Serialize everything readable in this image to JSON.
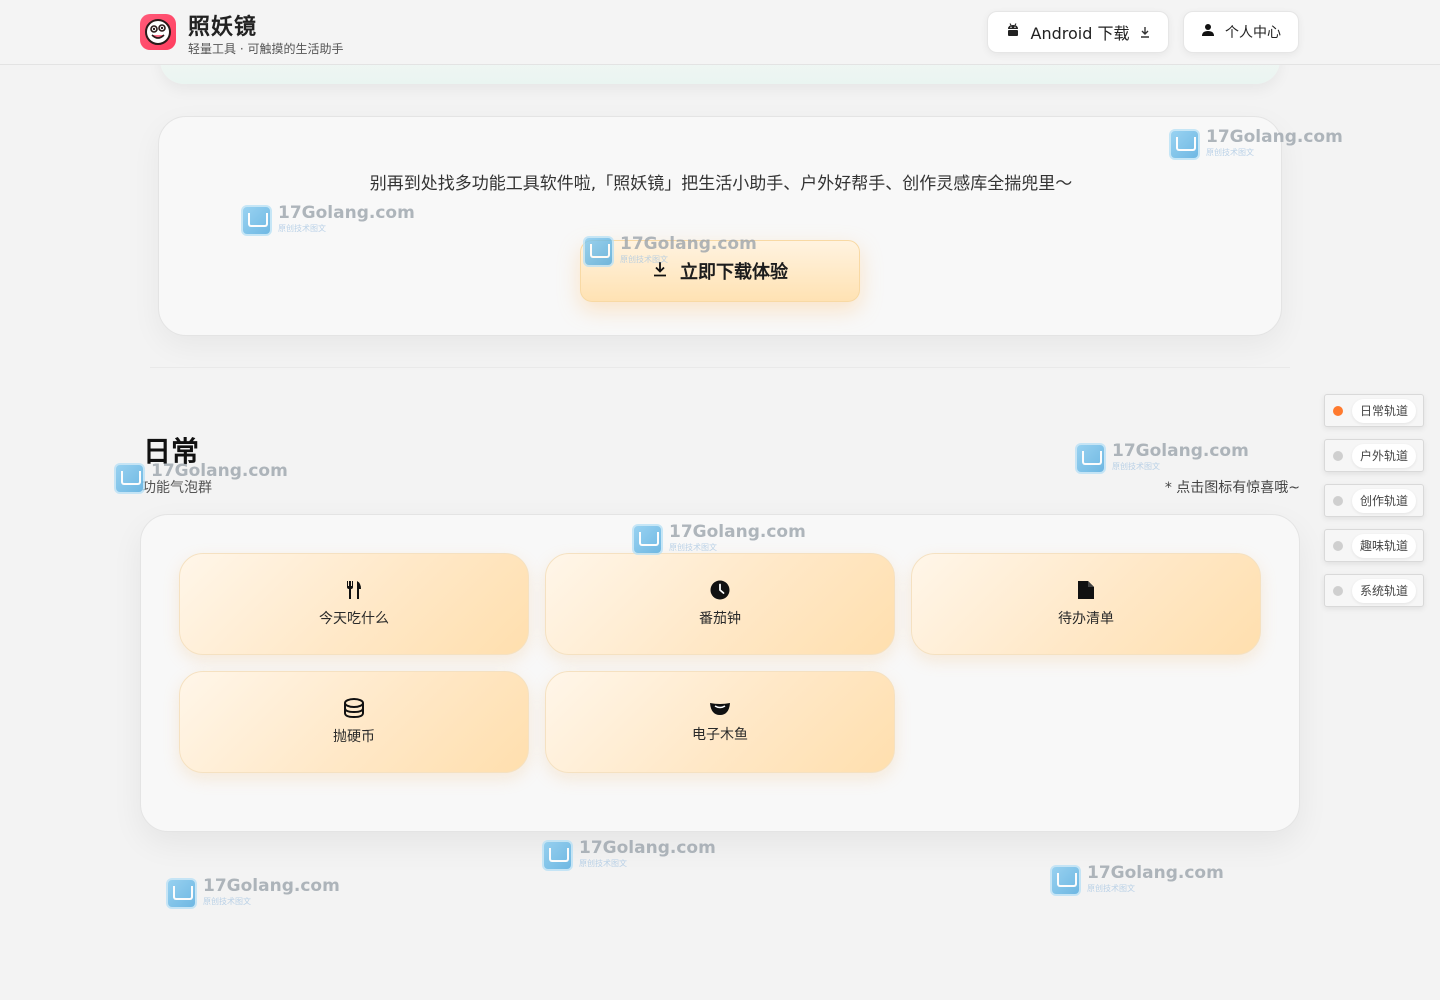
{
  "header": {
    "app_name": "照妖镜",
    "tagline": "轻量工具 · 可触摸的生活助手",
    "android_button": "Android 下载",
    "user_button": "个人中心"
  },
  "promo": {
    "text": "别再到处找多功能工具软件啦,「照妖镜」把生活小助手、户外好帮手、创作灵感库全揣兜里～",
    "cta_label": "立即下载体验"
  },
  "section": {
    "title": "日常",
    "subtitle": "功能气泡群",
    "hint": "* 点击图标有惊喜哦~"
  },
  "tools": [
    {
      "label": "今天吃什么",
      "icon": "fork-knife-icon"
    },
    {
      "label": "番茄钟",
      "icon": "clock-icon"
    },
    {
      "label": "待办清单",
      "icon": "document-icon"
    },
    {
      "label": "抛硬币",
      "icon": "coins-icon"
    },
    {
      "label": "电子木鱼",
      "icon": "wooden-fish-icon"
    }
  ],
  "side_nav": [
    {
      "label": "日常轨道",
      "active": true
    },
    {
      "label": "户外轨道",
      "active": false
    },
    {
      "label": "创作轨道",
      "active": false
    },
    {
      "label": "趣味轨道",
      "active": false
    },
    {
      "label": "系统轨道",
      "active": false
    }
  ],
  "watermark": {
    "text": "17Golang.com",
    "subtext": "原创技术图文"
  },
  "colors": {
    "accent_active": "#ff7a2e",
    "cta_gradient": "#ffe2b3",
    "tool_card": "#ffe8c7"
  }
}
